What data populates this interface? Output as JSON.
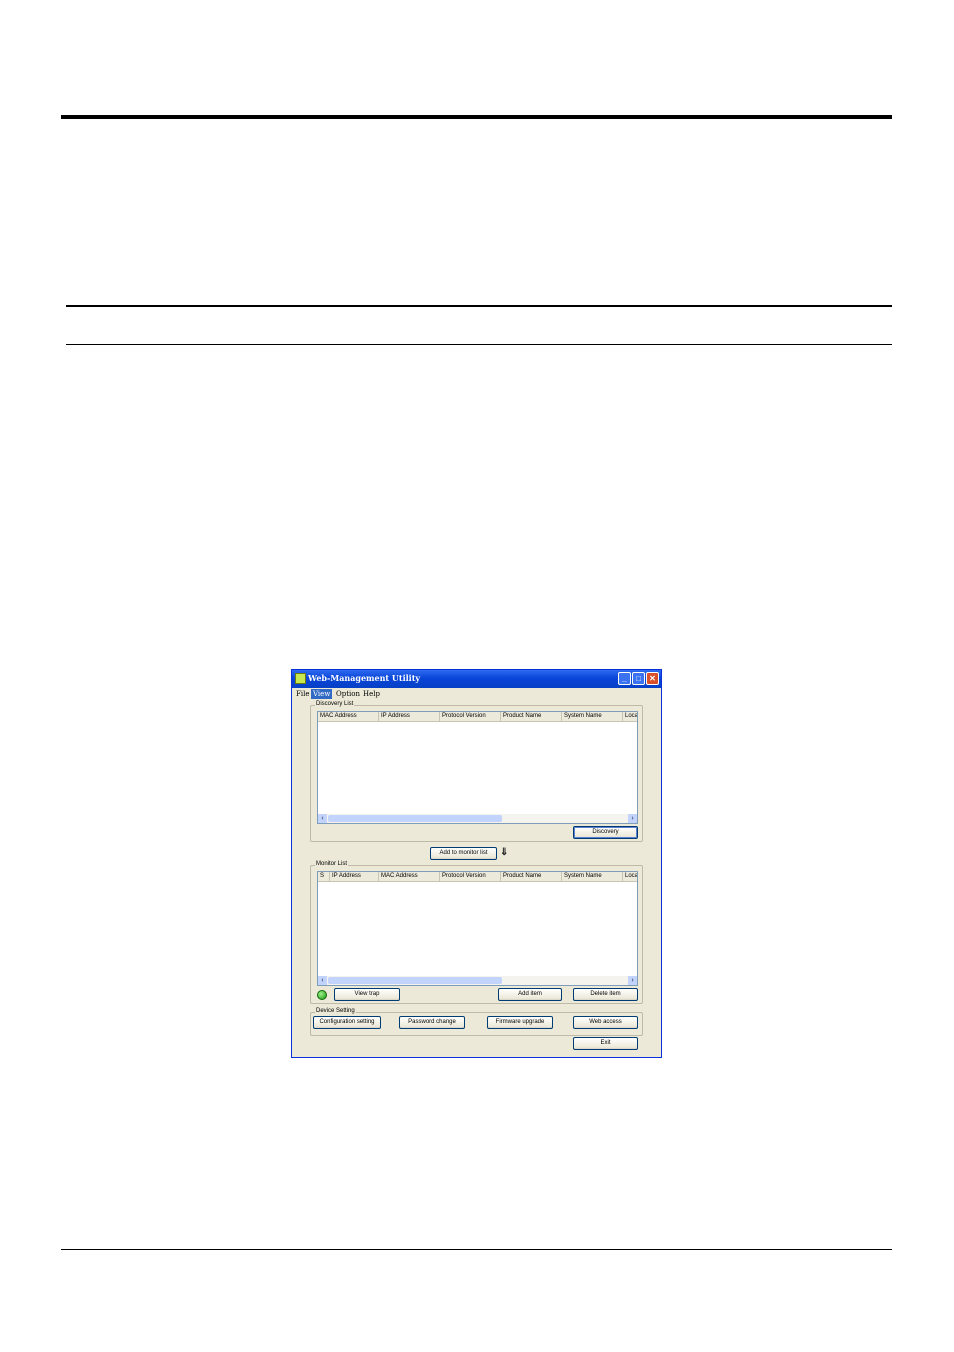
{
  "window": {
    "title": "Web-Management Utility",
    "controls": {
      "minimize": "_",
      "maximize": "□",
      "close": "✕"
    }
  },
  "menu": [
    {
      "label": "File"
    },
    {
      "label": "View"
    },
    {
      "label": "Option"
    },
    {
      "label": "Help"
    }
  ],
  "discovery": {
    "group_label": "Discovery List",
    "columns": [
      "MAC Address",
      "IP Address",
      "Protocol Version",
      "Product Name",
      "System Name",
      "Loca"
    ],
    "discovery_button": "Discovery"
  },
  "add_to_monitor_button": "Add to monitor list",
  "monitor": {
    "group_label": "Monitor List",
    "columns": [
      "S",
      "IP Address",
      "MAC Address",
      "Protocol Version",
      "Product Name",
      "System Name",
      "Loca"
    ],
    "view_trap_button": "View trap",
    "add_item_button": "Add item",
    "delete_item_button": "Delete item"
  },
  "device_setting": {
    "group_label": "Device Setting",
    "configuration_button": "Configuration setting",
    "password_button": "Password change",
    "firmware_button": "Firmware upgrade",
    "web_access_button": "Web access"
  },
  "exit_button": "Exit",
  "icons": {
    "app": "app-icon",
    "status_led": "status-led-icon",
    "down_arrow": "down-arrow-icon",
    "scroll_left": "scroll-left-icon",
    "scroll_right": "scroll-right-icon"
  },
  "colors": {
    "titlebar": "#0a46d8",
    "window_bg": "#ece9d8",
    "menu_highlight": "#316ac5",
    "close_button": "#d8502a",
    "status_led": "#1c9a12"
  }
}
